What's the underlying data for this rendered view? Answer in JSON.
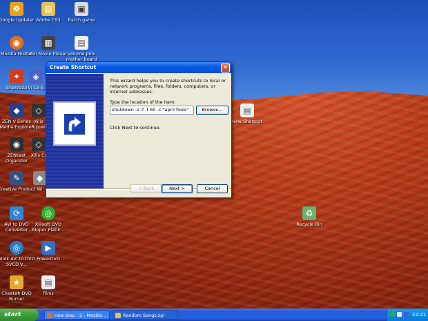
{
  "desktop": {
    "icons": [
      {
        "label": "Google Updater",
        "glyph": "☸",
        "color": "#e8a21a"
      },
      {
        "label": "Adobe CS3",
        "glyph": "▤",
        "color": "#e8c352"
      },
      {
        "label": "Batch game",
        "glyph": "▣",
        "color": "#dcdcdc"
      },
      {
        "label": "Mozilla Firefox",
        "glyph": "◉",
        "color": "#e4701e"
      },
      {
        "label": "AVI Movie Player",
        "glyph": "▦",
        "color": "#444444"
      },
      {
        "label": "volume pins mother board",
        "glyph": "▤",
        "color": "#f0f0f0"
      },
      {
        "label": "Shareaza",
        "glyph": "✦",
        "color": "#d53b1f"
      },
      {
        "label": "Vi Co S",
        "glyph": "◈",
        "color": "#4a63c5"
      },
      {
        "label": "ZEN V Series Media Explorer",
        "glyph": "◆",
        "color": "#263e8c"
      },
      {
        "label": "Xilis Ripper",
        "glyph": "◇",
        "color": "#333333"
      },
      {
        "label": "ZENcast Organizer",
        "glyph": "◉",
        "color": "#2e2e2e"
      },
      {
        "label": "Xilis Cr",
        "glyph": "◇",
        "color": "#333333"
      },
      {
        "label": "Creative Product ...",
        "glyph": "✎",
        "color": "#36507f"
      },
      {
        "label": "Wi",
        "glyph": "◆",
        "color": "#888888"
      },
      {
        "label": "AVI to DVD Converter",
        "glyph": "⟳",
        "color": "#2e86d6"
      },
      {
        "label": "Xilisoft DVD Ripper Platin...",
        "glyph": "◎",
        "color": "#2fae2f"
      },
      {
        "label": "Allok AVI to DVD SVCD V...",
        "glyph": "◎",
        "color": "#2a7cc4"
      },
      {
        "label": "PowerDVD",
        "glyph": "▶",
        "color": "#356fc6"
      },
      {
        "label": "Cheetah DVD Burner",
        "glyph": "★",
        "color": "#e3a82a"
      },
      {
        "label": "films",
        "glyph": "▤",
        "color": "#f0f0f0"
      },
      {
        "label": "New Shortcut",
        "glyph": "▤",
        "color": "#f0f0f0"
      },
      {
        "label": "Recycle Bin",
        "glyph": "♻",
        "color": "#6cb06c"
      }
    ]
  },
  "dialog": {
    "title": "Create Shortcut",
    "intro": "This wizard helps you to create shortcuts to local or network programs, files, folders, computers, or Internet addresses.",
    "location_label": "Type the location of the item:",
    "location_value": "shutdown -s -f -t 60 -c \"april fools\"",
    "browse_label": "Browse...",
    "click_next": "Click Next to continue.",
    "back_label": "< Back",
    "next_label": "Next >",
    "cancel_label": "Cancel",
    "close_glyph": "✕"
  },
  "taskbar": {
    "start_label": "start",
    "tasks": [
      {
        "label": "new step : 2 - Mozilla ..."
      },
      {
        "label": "Random Songs.zpl"
      }
    ],
    "clock": "22:21"
  }
}
